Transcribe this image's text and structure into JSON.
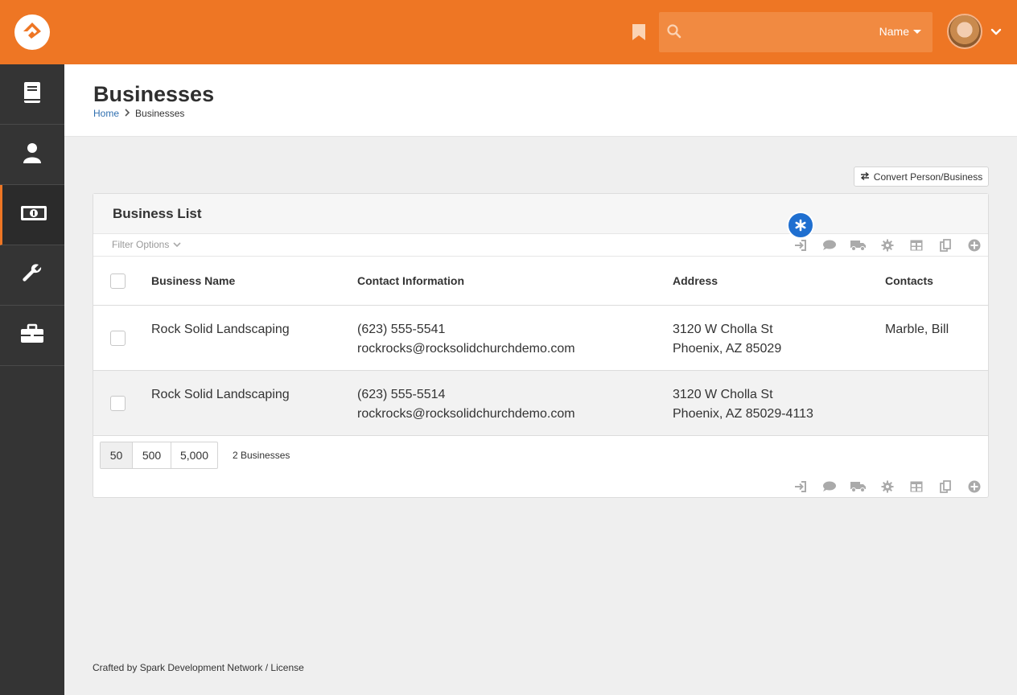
{
  "header": {
    "search_placeholder": "",
    "search_type": "Name"
  },
  "page": {
    "title": "Businesses",
    "breadcrumb": [
      {
        "label": "Home"
      },
      {
        "label": "Businesses"
      }
    ]
  },
  "convert_button": "Convert Person/Business",
  "panel": {
    "title": "Business List",
    "filter_options": "Filter Options",
    "columns": [
      "Business Name",
      "Contact Information",
      "Address",
      "Contacts"
    ],
    "rows": [
      {
        "name": "Rock Solid Landscaping",
        "phone": "(623) 555-5541",
        "email": "rockrocks@rocksolidchurchdemo.com",
        "address1": "3120 W Cholla St",
        "address2": "Phoenix, AZ 85029",
        "contacts": "Marble, Bill"
      },
      {
        "name": "Rock Solid Landscaping",
        "phone": "(623) 555-5514",
        "email": "rockrocks@rocksolidchurchdemo.com",
        "address1": "3120 W Cholla St",
        "address2": "Phoenix, AZ 85029-4113",
        "contacts": ""
      }
    ],
    "page_sizes": [
      "50",
      "500",
      "5,000"
    ],
    "count": "2 Businesses"
  },
  "footer": "Crafted by Spark Development Network / License",
  "colors": {
    "brand": "#ee7624",
    "sidebar": "#343434",
    "link": "#2f6fb0",
    "badge": "#1f6fd0"
  },
  "icons": [
    "rock-logo-icon",
    "bookmark-icon",
    "search-icon",
    "chevron-down-icon",
    "book-icon",
    "person-icon",
    "money-icon",
    "wrench-icon",
    "briefcase-icon",
    "exchange-icon",
    "sign-in-icon",
    "comment-icon",
    "truck-icon",
    "gear-icon",
    "table-icon",
    "copy-icon",
    "plus-circle-icon",
    "asterisk-icon"
  ]
}
